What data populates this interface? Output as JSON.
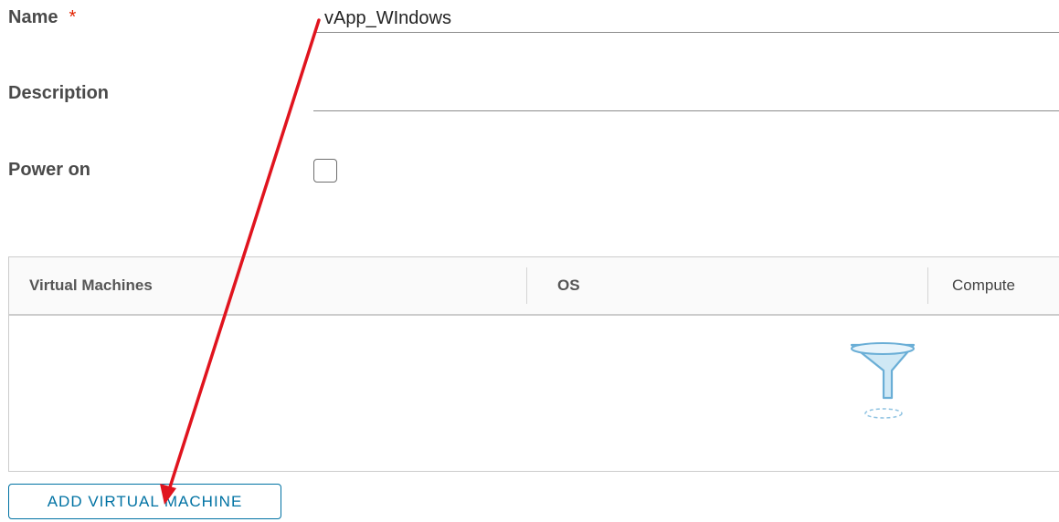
{
  "form": {
    "name_label": "Name",
    "required_marker": "*",
    "name_value": "vApp_WIndows",
    "description_label": "Description",
    "description_value": "",
    "power_on_label": "Power on",
    "power_on_checked": false
  },
  "grid": {
    "columns": [
      "Virtual Machines",
      "OS",
      "Compute"
    ],
    "rows": [],
    "empty_icon": "funnel-icon"
  },
  "actions": {
    "add_vm_label": "ADD VIRTUAL MACHINE"
  },
  "annotation": {
    "arrow_color": "#e0141e"
  },
  "colors": {
    "accent": "#0072a3",
    "required": "#e12200"
  }
}
